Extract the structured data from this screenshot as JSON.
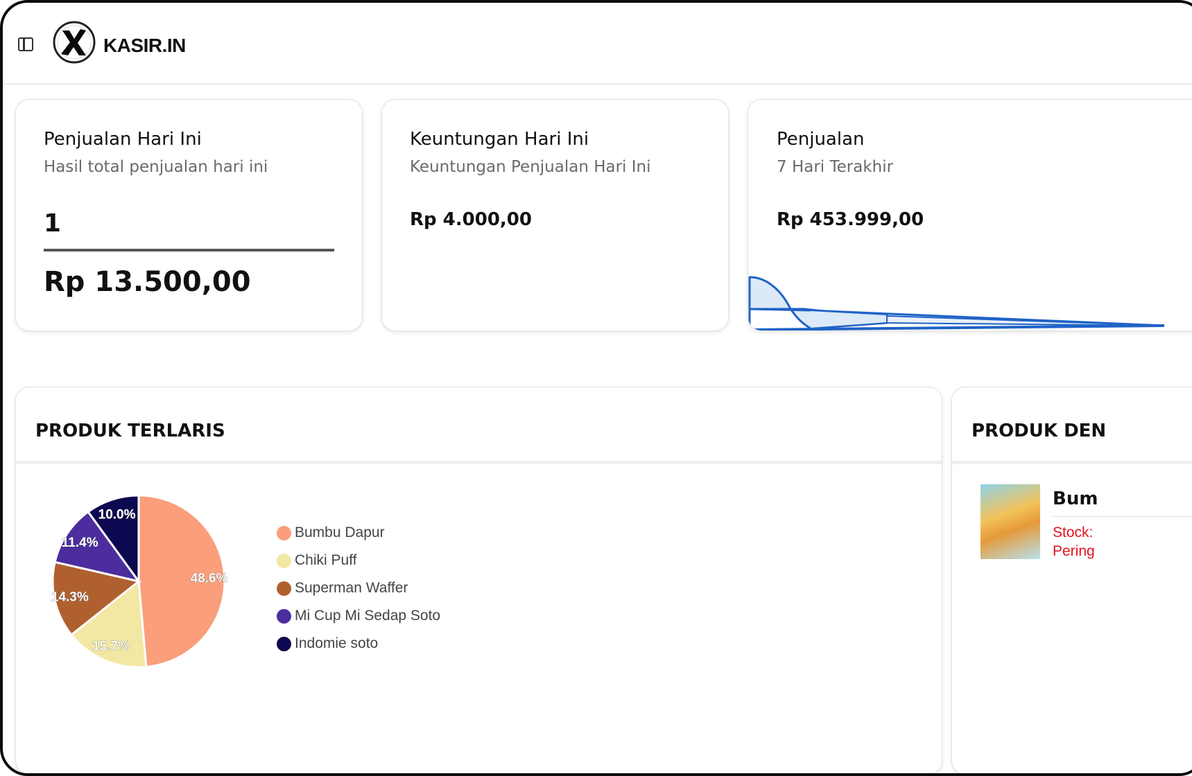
{
  "app": {
    "brand": "KASIR.IN"
  },
  "icons": {
    "sidebar_toggle": "sidebar-toggle-icon",
    "logo": "kasirin-logo"
  },
  "stats": {
    "sales_today": {
      "title": "Penjualan Hari Ini",
      "subtitle": "Hasil total penjualan hari ini",
      "count": "1",
      "amount": "Rp 13.500,00"
    },
    "profit_today": {
      "title": "Keuntungan Hari Ini",
      "subtitle": "Keuntungan Penjualan Hari Ini",
      "amount": "Rp 4.000,00"
    },
    "sales_week": {
      "title": "Penjualan",
      "subtitle": "7 Hari Terakhir",
      "amount": "Rp 453.999,00"
    }
  },
  "best_sellers": {
    "title": "PRODUK TERLARIS",
    "chart_data": {
      "type": "pie",
      "categories": [
        "Bumbu Dapur",
        "Chiki Puff",
        "Superman Waffer",
        "Mi Cup Mi Sedap Soto",
        "Indomie soto"
      ],
      "values": [
        48.6,
        15.7,
        14.3,
        11.4,
        10.0
      ],
      "labels": [
        "48.6%",
        "15.7%",
        "14.3%",
        "11.4%",
        "10.0%"
      ],
      "colors": [
        "#fa9e7c",
        "#f3e7a4",
        "#b0602f",
        "#4b2d9e",
        "#0d0950"
      ],
      "legend": "right"
    }
  },
  "low_stock": {
    "title": "PRODUK DEN",
    "product_name": "Bum",
    "stock_text": "Stock:",
    "warning_text": "Pering"
  }
}
